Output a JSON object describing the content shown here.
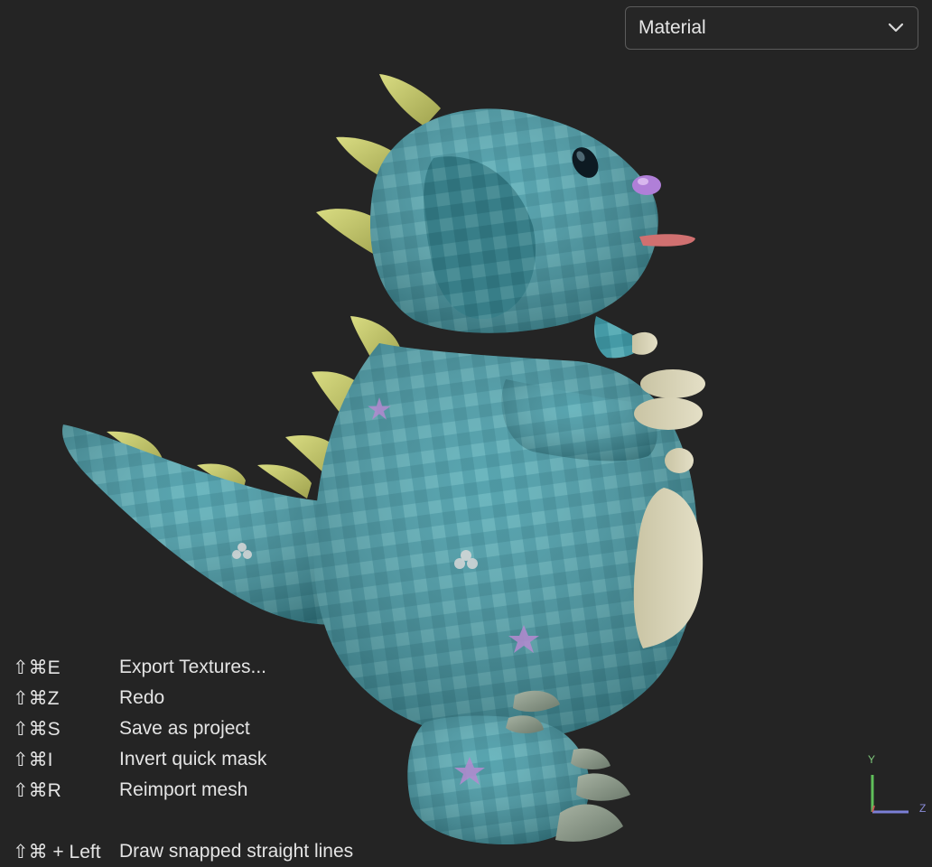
{
  "view_mode": {
    "selected": "Material"
  },
  "shortcuts": [
    {
      "keys": "⇧⌘E",
      "label": "Export Textures..."
    },
    {
      "keys": "⇧⌘Z",
      "label": "Redo"
    },
    {
      "keys": "⇧⌘S",
      "label": "Save as project"
    },
    {
      "keys": "⇧⌘I",
      "label": "Invert quick mask"
    },
    {
      "keys": "⇧⌘R",
      "label": "Reimport mesh"
    },
    {
      "keys": "⇧⌘ + Left",
      "label": "Draw snapped straight lines"
    }
  ],
  "axis_gizmo": {
    "y_label": "Y",
    "z_label": "Z"
  },
  "colors": {
    "background": "#242424",
    "body_fabric": "#3a8a96",
    "spikes": "#c8c86e",
    "belly": "#d8d3b5",
    "claws": "#8a9a88",
    "nose": "#b07fd8",
    "tongue": "#d07070",
    "axis_y": "#5fbf5a",
    "axis_z": "#7b7fd6"
  }
}
